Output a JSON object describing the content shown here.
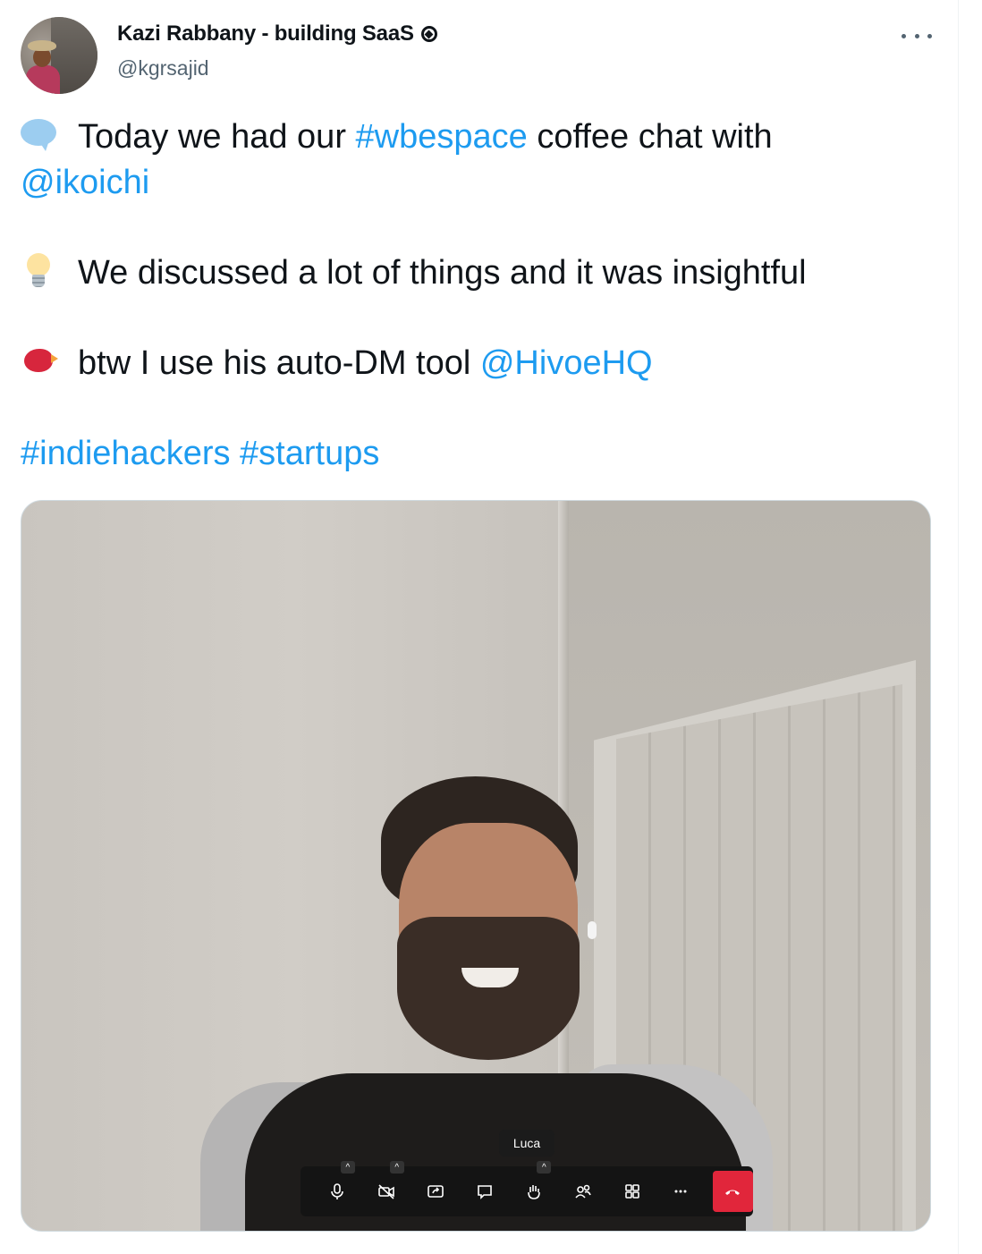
{
  "author": {
    "display_name": "Kazi Rabbany - building SaaS",
    "handle": "@kgrsajid"
  },
  "tweet": {
    "line1_text": "Today we had our ",
    "line1_hashtag": "#wbespace",
    "line1_suffix": " coffee chat with",
    "line2_mention": "@ikoichi",
    "line3_text": "We discussed a lot of things and it was insightful",
    "line4_text": "btw I use his auto-DM tool ",
    "line4_mention": "@HivoeHQ",
    "line5_hashtag_1": "#indiehackers",
    "line5_hashtag_2": "#startups"
  },
  "media": {
    "participant_name": "Luca",
    "controls": [
      "microphone-icon",
      "camera-off-icon",
      "share-screen-icon",
      "chat-icon",
      "raise-hand-icon",
      "participants-icon",
      "grid-view-icon",
      "more-icon",
      "hang-up-icon"
    ]
  },
  "colors": {
    "link": "#1d9bf0",
    "text": "#0f1419",
    "muted": "#536471",
    "hangup": "#e1263b"
  }
}
